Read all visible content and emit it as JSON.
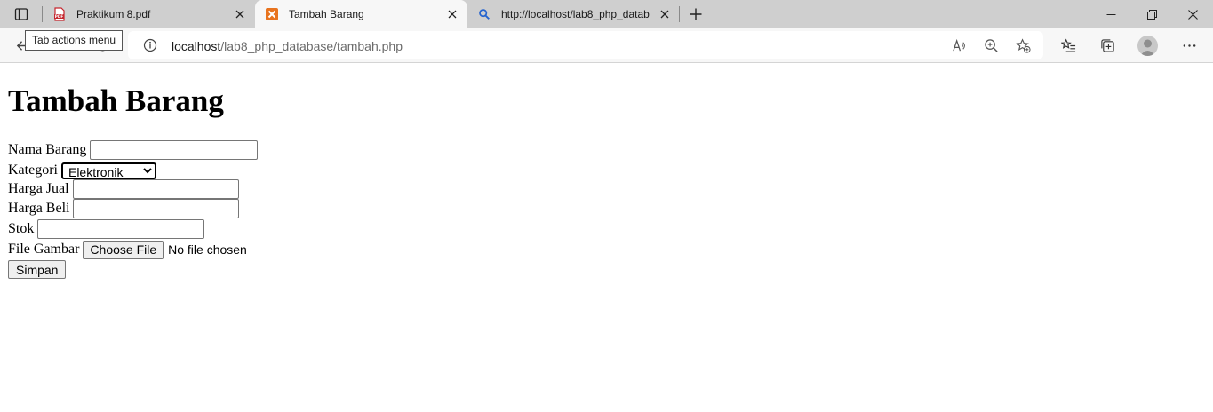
{
  "browser": {
    "tooltip": "Tab actions menu",
    "tabs": [
      {
        "title": "Praktikum 8.pdf",
        "favicon": "pdf-icon",
        "active": false
      },
      {
        "title": "Tambah Barang",
        "favicon": "xampp-icon",
        "active": true
      },
      {
        "title": "http://localhost/lab8_php_datab",
        "favicon": "search-icon",
        "active": false
      }
    ],
    "address": {
      "host": "localhost",
      "path": "/lab8_php_database/tambah.php"
    }
  },
  "page": {
    "heading": "Tambah Barang",
    "form": {
      "nama_label": "Nama Barang",
      "nama_value": "",
      "kategori_label": "Kategori",
      "kategori_selected": "Elektronik",
      "harga_jual_label": "Harga Jual",
      "harga_jual_value": "",
      "harga_beli_label": "Harga Beli",
      "harga_beli_value": "",
      "stok_label": "Stok",
      "stok_value": "",
      "gambar_label": "File Gambar",
      "choose_file_label": "Choose File",
      "no_file_text": "No file chosen",
      "submit_label": "Simpan"
    }
  },
  "colors": {
    "tabstrip_bg": "#cfcfcf",
    "toolbar_bg": "#f7f7f7",
    "pdf_icon": "#c6262e",
    "xampp_icon": "#e8731e",
    "search_icon": "#2564cf"
  }
}
